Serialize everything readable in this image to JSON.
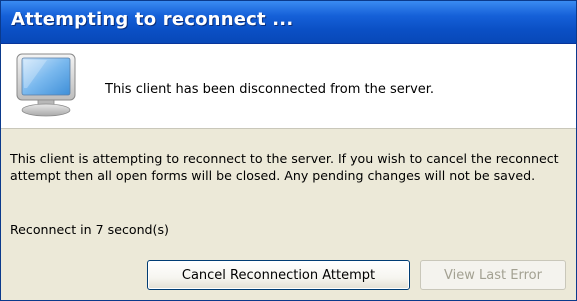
{
  "window": {
    "title": "Attempting to reconnect ..."
  },
  "header_panel": {
    "icon": "monitor-icon",
    "message": "This client has been disconnected from the server."
  },
  "body": {
    "message": "This client is attempting to reconnect to the server.  If you wish to cancel the reconnect attempt then all open forms will be closed.  Any pending changes will not be saved.",
    "countdown": "Reconnect in 7 second(s)"
  },
  "buttons": {
    "cancel_label": "Cancel Reconnection Attempt",
    "view_error_label": "View Last Error",
    "view_error_enabled": false
  },
  "colors": {
    "titlebar": "#0a4fc4",
    "dialog_bg": "#ece9d8",
    "panel_bg": "#ffffff",
    "disabled_text": "#a3a192"
  }
}
